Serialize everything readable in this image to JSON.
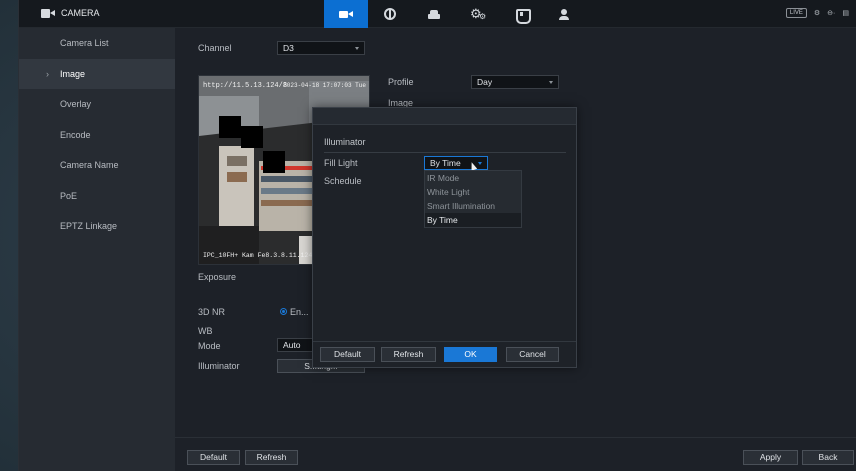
{
  "app": {
    "title": "CAMERA",
    "live": "LIVE"
  },
  "topnav": [
    {
      "icon": "camera-icon",
      "active": true
    },
    {
      "icon": "network-icon"
    },
    {
      "icon": "storage-icon"
    },
    {
      "icon": "system-icon"
    },
    {
      "icon": "security-icon"
    },
    {
      "icon": "account-icon"
    }
  ],
  "topright": {
    "user": "⚙",
    "logout": "⊖·",
    "menu": "▤"
  },
  "sidebar": {
    "items": [
      {
        "label": "Camera List"
      },
      {
        "label": "Image",
        "active": true
      },
      {
        "label": "Overlay"
      },
      {
        "label": "Encode"
      },
      {
        "label": "Camera Name"
      },
      {
        "label": "PoE"
      },
      {
        "label": "EPTZ Linkage"
      }
    ]
  },
  "main": {
    "channel_label": "Channel",
    "channel_value": "D3",
    "profile_label": "Profile",
    "profile_value": "Day",
    "image_label": "Image",
    "exposure_label": "Exposure",
    "nr3d_label": "3D NR",
    "nr3d_value": "En...",
    "wb_label": "WB",
    "mode_label": "Mode",
    "mode_value": "Auto",
    "illuminator_label": "Illuminator",
    "illuminator_btn": "S...ting...",
    "preview": {
      "osd_top_left": "http://11.5.13.124/8",
      "osd_top_right": "2023-04-18 17:07:03 Tue",
      "osd_bottom": "IPC_10FH+ Kam Fe8.3.8.11.124"
    }
  },
  "bottom": {
    "default": "Default",
    "refresh": "Refresh",
    "apply": "Apply",
    "back": "Back"
  },
  "dialog": {
    "section": "Illuminator",
    "fill_light_label": "Fill Light",
    "fill_light_value": "By Time",
    "schedule_label": "Schedule",
    "options": [
      "IR Mode",
      "White Light",
      "Smart Illumination",
      "By Time"
    ],
    "selected_option": "By Time",
    "buttons": {
      "default": "Default",
      "refresh": "Refresh",
      "ok": "OK",
      "cancel": "Cancel"
    }
  },
  "colors": {
    "accent": "#1a78d6",
    "bg": "#1d2128",
    "sidebar": "#262b32"
  }
}
